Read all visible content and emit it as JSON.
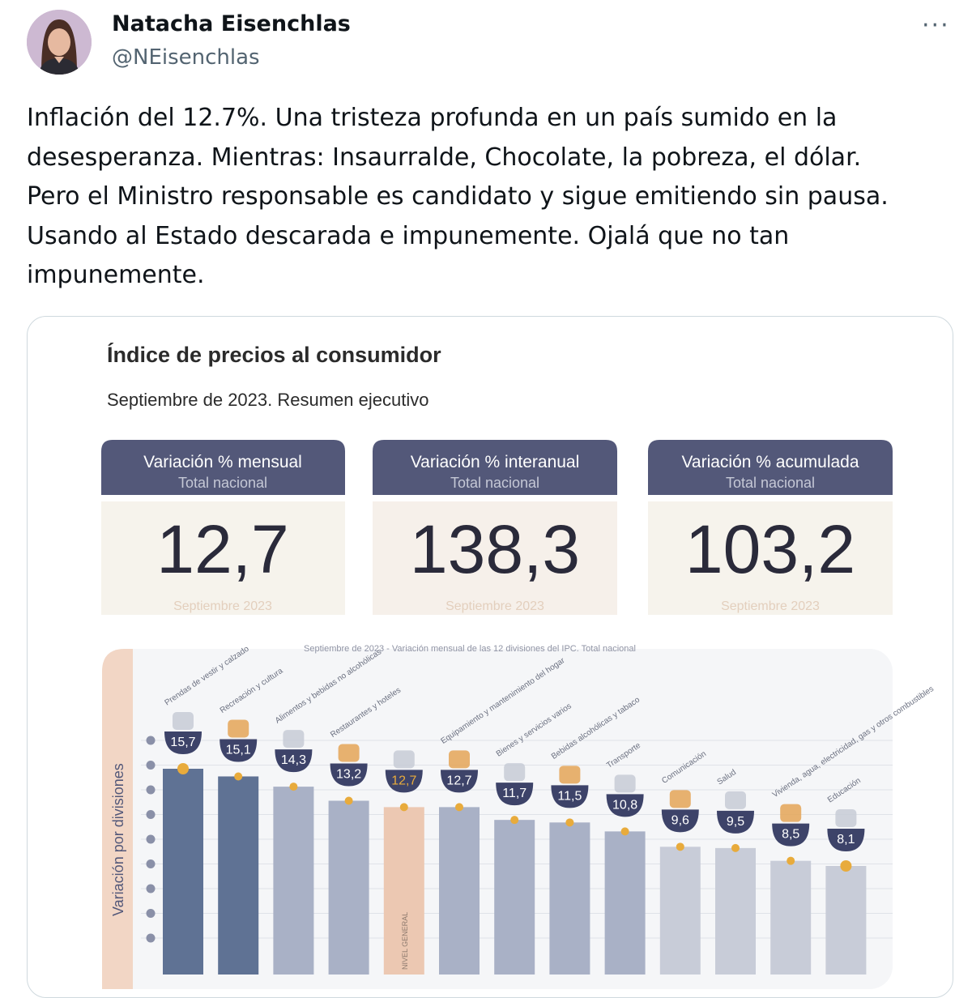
{
  "author": {
    "name": "Natacha Eisenchlas",
    "handle": "@NEisenchlas"
  },
  "more_label": "···",
  "tweet_lines": [
    "Inflación del 12.7%. Una tristeza profunda en un país sumido en la",
    "desesperanza. Mientras: Insaurralde, Chocolate, la pobreza, el dólar.",
    "Pero el Ministro responsable es candidato y sigue emitiendo sin pausa.",
    "Usando al Estado descarada e impunemente. Ojalá que no tan",
    "impunemente."
  ],
  "infographic": {
    "title": "Índice de precios al consumidor",
    "subtitle": "Septiembre de 2023. Resumen ejecutivo",
    "cards": [
      {
        "label": "Variación % mensual",
        "sub": "Total nacional",
        "value": "12,7",
        "period": "Septiembre 2023"
      },
      {
        "label": "Variación % interanual",
        "sub": "Total nacional",
        "value": "138,3",
        "period": "Septiembre 2023"
      },
      {
        "label": "Variación % acumulada",
        "sub": "Total nacional",
        "value": "103,2",
        "period": "Septiembre 2023"
      }
    ]
  },
  "chart_data": {
    "type": "bar",
    "title": "Septiembre de 2023 - Variación mensual de las 12 divisiones del IPC. Total nacional",
    "ylabel": "Variación por divisiones",
    "general_label": "NIVEL GENERAL",
    "categories": [
      "Prendas de vestir y calzado",
      "Recreación y cultura",
      "Alimentos y bebidas no alcohólicas",
      "Restaurantes y hoteles",
      "",
      "Equipamiento y mantenimiento del hogar",
      "Bienes y servicios varios",
      "Bebidas alcohólicas y tabaco",
      "Transporte",
      "Comunicación",
      "Salud",
      "Vivienda, agua, electricidad, gas y otros combustibles",
      "Educación"
    ],
    "values": [
      15.7,
      15.1,
      14.3,
      13.2,
      12.7,
      12.7,
      11.7,
      11.5,
      10.8,
      9.6,
      9.5,
      8.5,
      8.1
    ],
    "value_labels": [
      "15,7",
      "15,1",
      "14,3",
      "13,2",
      "12,7",
      "12,7",
      "11,7",
      "11,5",
      "10,8",
      "9,6",
      "9,5",
      "8,5",
      "8,1"
    ],
    "highlight_index": 4,
    "colors": {
      "bar_dark": "#5f7294",
      "bar_mid": "#a9b1c6",
      "bar_light": "#c8ccd8",
      "bar_general": "#ecc8b2",
      "badge": "#3d4369",
      "accent": "#e8ab3c",
      "header_bg": "#535879"
    }
  }
}
